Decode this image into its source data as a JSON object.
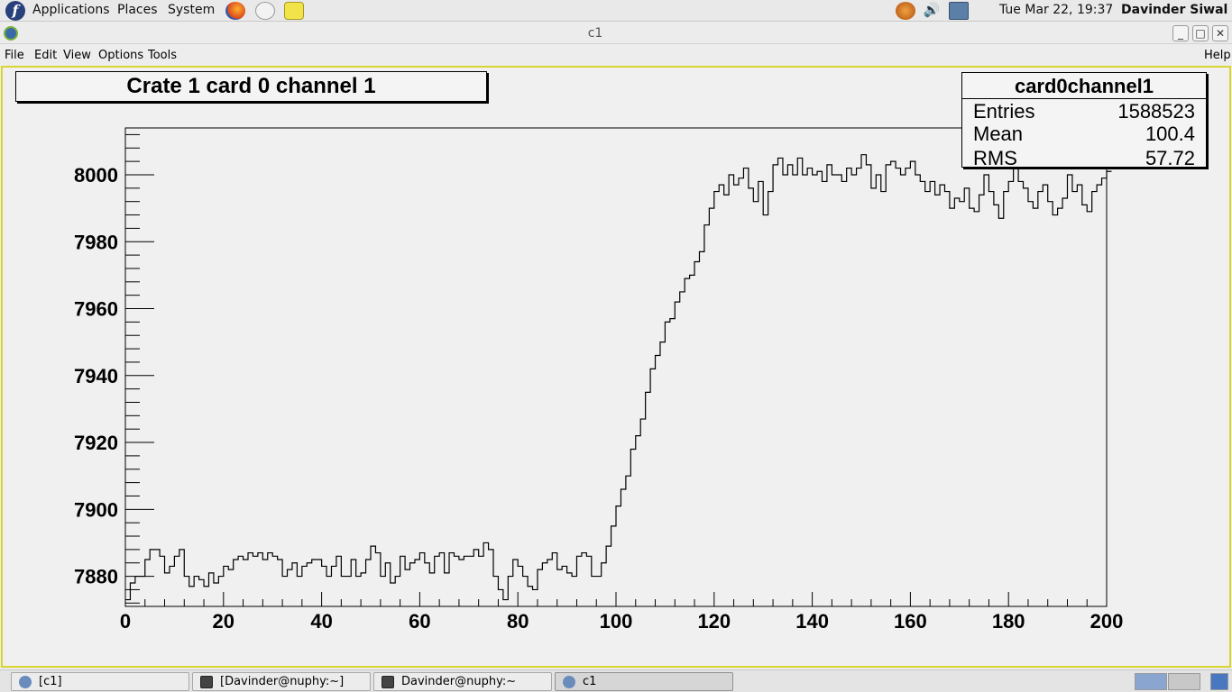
{
  "top_panel": {
    "menus": [
      "Applications",
      "Places",
      "System"
    ],
    "launchers": [
      "firefox-icon",
      "mail-icon",
      "notes-icon"
    ],
    "tray_icons": [
      "update-icon",
      "volume-icon",
      "network-icon"
    ],
    "clock": "Tue Mar 22, 19:37",
    "user": "Davinder Siwal"
  },
  "window": {
    "title": "c1",
    "controls": [
      "minimize",
      "maximize",
      "close"
    ]
  },
  "menubar": {
    "left": [
      {
        "label": "File",
        "mnemonic": "F"
      },
      {
        "label": "Edit",
        "mnemonic": "E"
      },
      {
        "label": "View",
        "mnemonic": "V"
      },
      {
        "label": "Options",
        "mnemonic": "O"
      },
      {
        "label": "Tools",
        "mnemonic": "T"
      }
    ],
    "help": "Help"
  },
  "canvas": {
    "title": "Crate 1 card 0 channel 1",
    "stats": {
      "name": "card0channel1",
      "entries_label": "Entries",
      "entries": "1588523",
      "mean_label": "Mean",
      "mean": "100.4",
      "rms_label": "RMS",
      "rms": "57.72"
    }
  },
  "chart_data": {
    "type": "line",
    "title": "Crate 1 card 0 channel 1",
    "xlabel": "",
    "ylabel": "",
    "xlim": [
      0,
      200
    ],
    "ylim": [
      7871,
      8014
    ],
    "x_ticks": [
      "0",
      "20",
      "40",
      "60",
      "80",
      "100",
      "120",
      "140",
      "160",
      "180",
      "200"
    ],
    "y_ticks": [
      "7880",
      "7900",
      "7920",
      "7940",
      "7960",
      "7980",
      "8000"
    ],
    "grid": false,
    "step_style": true,
    "bin_width": 1,
    "x_start": 0,
    "values": [
      7873,
      7878,
      7880,
      7880,
      7885,
      7888,
      7888,
      7886,
      7881,
      7883,
      7886,
      7888,
      7880,
      7877,
      7880,
      7879,
      7877,
      7881,
      7878,
      7880,
      7883,
      7882,
      7885,
      7886,
      7885,
      7887,
      7886,
      7887,
      7885,
      7887,
      7886,
      7885,
      7880,
      7882,
      7884,
      7880,
      7883,
      7884,
      7885,
      7885,
      7883,
      7880,
      7883,
      7886,
      7880,
      7880,
      7885,
      7880,
      7881,
      7885,
      7889,
      7887,
      7880,
      7884,
      7878,
      7880,
      7886,
      7882,
      7884,
      7885,
      7887,
      7884,
      7881,
      7886,
      7887,
      7881,
      7887,
      7886,
      7885,
      7886,
      7886,
      7888,
      7886,
      7890,
      7888,
      7880,
      7876,
      7873,
      7880,
      7885,
      7883,
      7880,
      7877,
      7876,
      7882,
      7884,
      7885,
      7887,
      7882,
      7883,
      7881,
      7880,
      7886,
      7887,
      7886,
      7880,
      7880,
      7884,
      7889,
      7895,
      7901,
      7906,
      7910,
      7918,
      7922,
      7927,
      7935,
      7942,
      7946,
      7950,
      7956,
      7957,
      7962,
      7965,
      7969,
      7970,
      7974,
      7977,
      7985,
      7990,
      7995,
      7997,
      7994,
      8000,
      7997,
      7999,
      8002,
      7996,
      7992,
      7998,
      7988,
      7995,
      8003,
      8005,
      8000,
      8003,
      8000,
      8005,
      8000,
      8002,
      8000,
      8001,
      7998,
      8003,
      8000,
      8000,
      7998,
      8002,
      8000,
      8002,
      8006,
      8003,
      7996,
      8000,
      7995,
      8003,
      8004,
      8002,
      8000,
      8002,
      8004,
      8000,
      7998,
      7995,
      7998,
      7994,
      7997,
      7995,
      7990,
      7993,
      7992,
      7996,
      7990,
      7989,
      7994,
      8000,
      7995,
      7991,
      7987,
      7995,
      7998,
      8003,
      7998,
      7996,
      7992,
      7990,
      7995,
      7997,
      7992,
      7988,
      7990,
      7993,
      8000,
      7995,
      7997,
      7991,
      7989,
      7995,
      7997,
      7999,
      8001
    ]
  },
  "taskbar": {
    "tasks": [
      {
        "label": "[c1]",
        "icon": "root-icon",
        "active": false
      },
      {
        "label": "[Davinder@nuphy:~]",
        "icon": "terminal-icon",
        "active": false
      },
      {
        "label": "Davinder@nuphy:~",
        "icon": "terminal-icon",
        "active": false
      },
      {
        "label": "c1",
        "icon": "root-icon",
        "active": true
      }
    ]
  },
  "colors": {
    "canvas_border": "#d9d52e",
    "plot_line": "#000000",
    "panel_bg": "#e9e9e9"
  }
}
